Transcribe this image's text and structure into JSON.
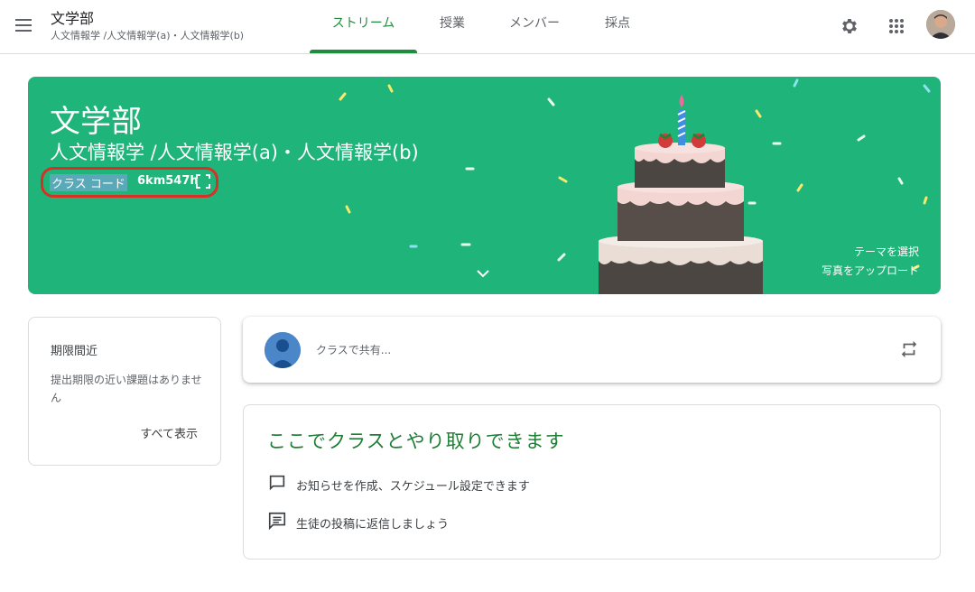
{
  "header": {
    "class_name": "文学部",
    "class_section": "人文情報学 /人文情報学(a)・人文情報学(b)",
    "tabs": [
      {
        "label": "ストリーム",
        "active": true
      },
      {
        "label": "授業",
        "active": false
      },
      {
        "label": "メンバー",
        "active": false
      },
      {
        "label": "採点",
        "active": false
      }
    ],
    "icons": [
      "menu-icon",
      "gear-icon",
      "apps-grid-icon",
      "account-avatar"
    ]
  },
  "banner": {
    "title": "文学部",
    "subtitle": "人文情報学 /人文情報学(a)・人文情報学(b)",
    "class_code_label": "クラス コード",
    "class_code": "6km547h",
    "select_theme": "テーマを選択",
    "upload_photo": "写真をアップロード",
    "theme_color": "#1fb47a"
  },
  "due_card": {
    "title": "期限間近",
    "text": "提出期限の近い課題はありません",
    "view_all": "すべて表示"
  },
  "share_card": {
    "placeholder": "クラスで共有..."
  },
  "info_card": {
    "title": "ここでクラスとやり取りできます",
    "items": [
      {
        "icon": "announcement-icon",
        "text": "お知らせを作成、スケジュール設定できます"
      },
      {
        "icon": "reply-comment-icon",
        "text": "生徒の投稿に返信しましょう"
      }
    ]
  },
  "colors": {
    "accent_green": "#1e8e3e",
    "highlight_red": "#d93025"
  }
}
